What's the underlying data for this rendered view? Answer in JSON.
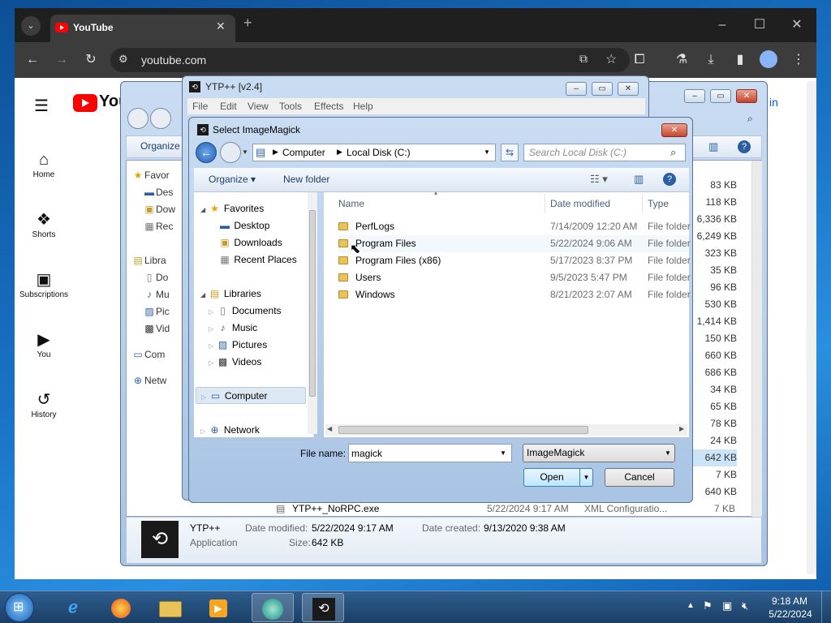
{
  "chrome": {
    "tab_title": "YouTube",
    "url": "youtube.com",
    "youtube_sidebar": [
      {
        "label": "Home",
        "icon": "home-icon"
      },
      {
        "label": "Shorts",
        "icon": "shorts-icon"
      },
      {
        "label": "Subscriptions",
        "icon": "subscriptions-icon"
      },
      {
        "label": "You",
        "icon": "you-icon"
      },
      {
        "label": "History",
        "icon": "history-icon"
      }
    ]
  },
  "explorer_bg": {
    "organize_label": "Organize",
    "nav_items": [
      "Favor",
      "Des",
      "Dow",
      "Rec",
      "Libra",
      "Do",
      "Mu",
      "Pic",
      "Vid",
      "Com",
      "Netw"
    ],
    "sizes": [
      "83 KB",
      "118 KB",
      "6,336 KB",
      "6,249 KB",
      "323 KB",
      "35 KB",
      "96 KB",
      "530 KB",
      "1,414 KB",
      "150 KB",
      "660 KB",
      "686 KB",
      "34 KB",
      "65 KB",
      "78 KB",
      "24 KB",
      "642 KB",
      "7 KB",
      "640 KB",
      "7 KB"
    ],
    "last_row": {
      "name": "YTP++_NoRPC.exe",
      "date": "5/22/2024 9:17 AM",
      "type": "XML Configuratio...",
      "size": "7 KB"
    },
    "details": {
      "name": "YTP++",
      "kind": "Application",
      "modified_label": "Date modified:",
      "modified": "5/22/2024 9:17 AM",
      "created_label": "Date created:",
      "created": "9/13/2020 9:38 AM",
      "size_label": "Size:",
      "size": "642 KB"
    }
  },
  "ytp": {
    "title": "YTP++ [v2.4]",
    "menu": [
      "File",
      "Edit",
      "View",
      "Tools",
      "Effects",
      "Help"
    ]
  },
  "dialog": {
    "title": "Select ImageMagick",
    "breadcrumb": [
      "Computer",
      "Local Disk (C:)"
    ],
    "search_placeholder": "Search Local Disk (C:)",
    "organize_label": "Organize",
    "new_folder_label": "New folder",
    "nav": {
      "favorites": "Favorites",
      "favorites_items": [
        "Desktop",
        "Downloads",
        "Recent Places"
      ],
      "libraries": "Libraries",
      "libraries_items": [
        "Documents",
        "Music",
        "Pictures",
        "Videos"
      ],
      "computer": "Computer",
      "network": "Network"
    },
    "columns": {
      "name": "Name",
      "date": "Date modified",
      "type": "Type"
    },
    "files": [
      {
        "name": "PerfLogs",
        "date": "7/14/2009 12:20 AM",
        "type": "File folder"
      },
      {
        "name": "Program Files",
        "date": "5/22/2024 9:06 AM",
        "type": "File folder"
      },
      {
        "name": "Program Files (x86)",
        "date": "5/17/2023 8:37 PM",
        "type": "File folder"
      },
      {
        "name": "Users",
        "date": "9/5/2023 5:47 PM",
        "type": "File folder"
      },
      {
        "name": "Windows",
        "date": "8/21/2023 2:07 AM",
        "type": "File folder"
      }
    ],
    "filename_label": "File name:",
    "filename_value": "magick",
    "filter_value": "ImageMagick",
    "open_label": "Open",
    "cancel_label": "Cancel"
  },
  "taskbar": {
    "time": "9:18 AM",
    "date": "5/22/2024"
  }
}
